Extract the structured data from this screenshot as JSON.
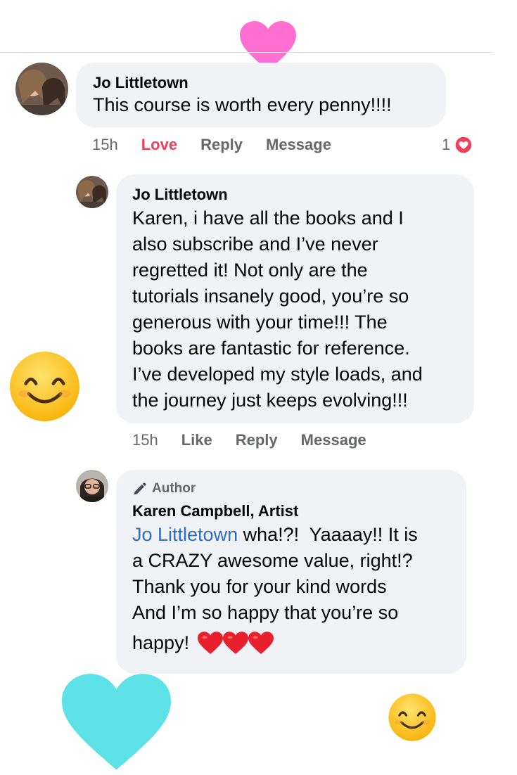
{
  "comment1": {
    "author": "Jo Littletown",
    "text": "This course is worth every penny!!!!",
    "time": "15h",
    "reaction_label": "Love",
    "reply_label": "Reply",
    "message_label": "Message",
    "reaction_count": "1"
  },
  "reply1": {
    "author": "Jo Littletown",
    "lines": [
      "Karen, i have all the books and I",
      "also subscribe and I’ve never",
      "regretted it! Not only are the",
      "tutorials insanely good, you’re so",
      "generous with your time!!! The",
      "books are fantastic for reference.",
      "I’ve developed my style loads, and",
      "the journey just keeps evolving!!!"
    ],
    "time": "15h",
    "like_label": "Like",
    "reply_label": "Reply",
    "message_label": "Message"
  },
  "reply2": {
    "badge": "Author",
    "author": "Karen Campbell, Artist",
    "mention": "Jo Littletown",
    "line1_rest": " wha!?!  Yaaaay!! It is",
    "line2": "a CRAZY awesome value, right!?",
    "line3": "Thank you for your kind words",
    "line4": "And I’m so happy that you’re so",
    "line5": "happy!"
  },
  "colors": {
    "bubble": "#f0f2f5",
    "love": "#f33e58",
    "mention": "#2d6cc9",
    "pink_heart": "#ff6fd1",
    "teal_heart": "#5ce1e6"
  }
}
